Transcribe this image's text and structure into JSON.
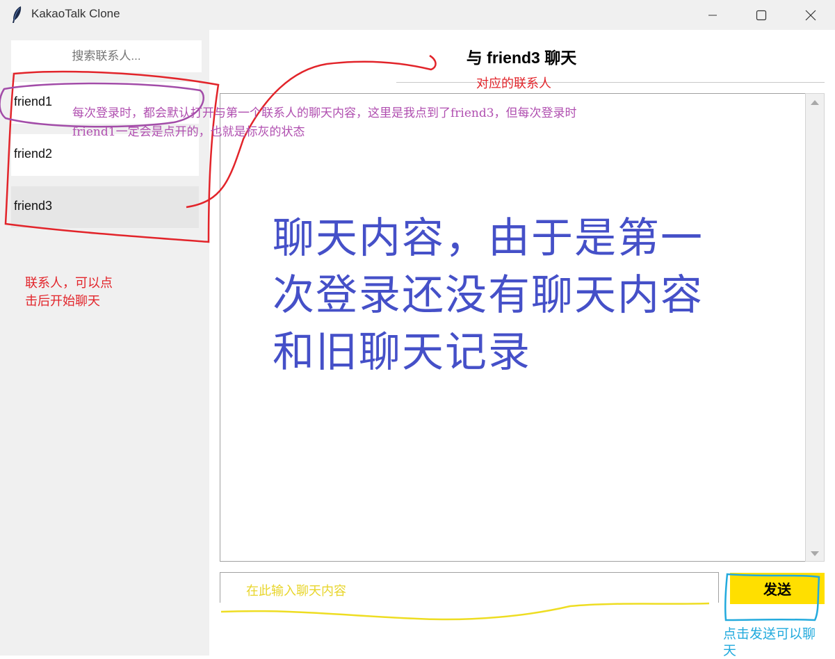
{
  "window": {
    "title": "KakaoTalk Clone",
    "controls": [
      "minimize-icon",
      "maximize-icon",
      "close-icon"
    ]
  },
  "sidebar": {
    "search_placeholder": "搜索联系人...",
    "contacts": [
      {
        "label": "friend1",
        "selected": false
      },
      {
        "label": "friend2",
        "selected": false
      },
      {
        "label": "friend3",
        "selected": true
      }
    ]
  },
  "chat": {
    "title": "与 friend3 聊天",
    "send_label": "发送"
  },
  "annotations": {
    "contact_header_note": "对应的联系人",
    "default_open_note_line1": "每次登录时，都会默认打开与第一个联系人的聊天内容，这里是我点到了friend3，但每次登录时",
    "default_open_note_line2": "friend1一定会是点开的，也就是标灰的状态",
    "contacts_note_line1": "联系人，可以点",
    "contacts_note_line2": "击后开始聊天",
    "chat_content_line1": "聊天内容，由于是第一",
    "chat_content_line2": "次登录还没有聊天内容",
    "chat_content_line3": "和旧聊天记录",
    "input_note": "在此输入聊天内容",
    "send_note_line1": "点击发送可以聊",
    "send_note_line2": "天"
  },
  "colors": {
    "send_button": "#ffdf00",
    "selected_contact": "#e6e6e6",
    "annotation_red": "#e2242a",
    "annotation_purple": "#b04fb0",
    "annotation_blue": "#4550c8",
    "annotation_yellow": "#e8d52a",
    "annotation_cyan": "#22aadd"
  }
}
